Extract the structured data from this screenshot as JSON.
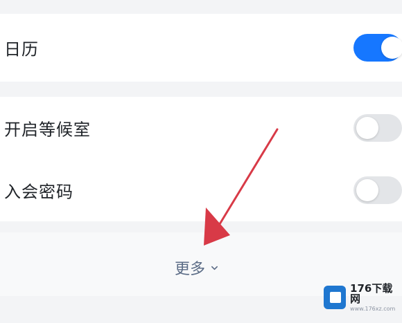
{
  "settings": {
    "calendar": {
      "label": "日历",
      "enabled": true
    },
    "waiting_room": {
      "label": "开启等候室",
      "enabled": false
    },
    "meeting_password": {
      "label": "入会密码",
      "enabled": false
    }
  },
  "more": {
    "label": "更多",
    "icon": "chevron-down-icon"
  },
  "annotation": {
    "type": "red-arrow",
    "color": "#d83a47"
  },
  "watermark": {
    "name": "176下载网",
    "url": "www.176xz.com"
  },
  "colors": {
    "accent": "#1677ff",
    "toggle_off": "#e3e5e8",
    "more_text": "#5b6c86"
  }
}
